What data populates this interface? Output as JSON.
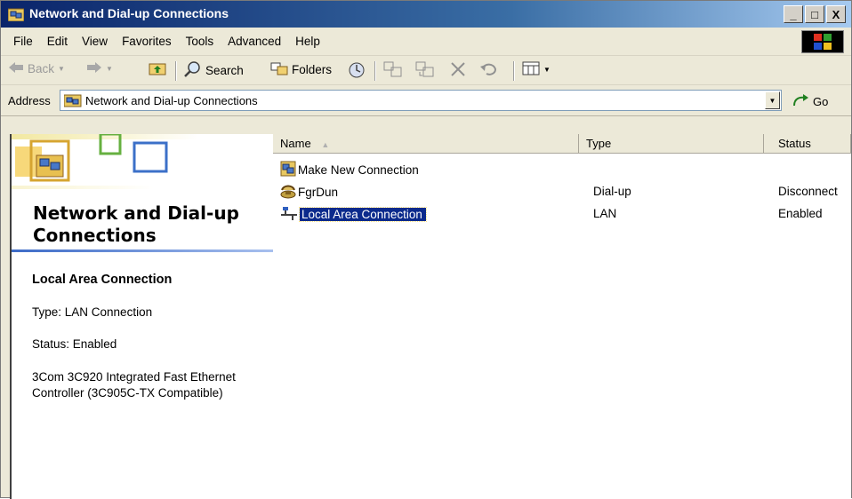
{
  "window": {
    "title": "Network and Dial-up Connections",
    "buttons": {
      "minimize": "_",
      "maximize": "□",
      "close": "X"
    }
  },
  "menu": [
    "File",
    "Edit",
    "View",
    "Favorites",
    "Tools",
    "Advanced",
    "Help"
  ],
  "toolbar": {
    "back": "Back",
    "search": "Search",
    "folders": "Folders"
  },
  "address": {
    "label": "Address",
    "value": "Network and Dial-up Connections",
    "go": "Go"
  },
  "left_pane": {
    "heading_line1": "Network and Dial-up",
    "heading_line2": "Connections",
    "selected_name": "Local Area Connection",
    "type": "Type: LAN Connection",
    "status": "Status: Enabled",
    "device_line1": "3Com 3C920 Integrated Fast Ethernet",
    "device_line2": "Controller (3C905C-TX Compatible)"
  },
  "list": {
    "columns": {
      "name": "Name",
      "type": "Type",
      "status": "Status"
    },
    "rows": [
      {
        "name": "Make New Connection",
        "type": "",
        "status": "",
        "icon": "new-connection-icon"
      },
      {
        "name": "FgrDun",
        "type": "Dial-up",
        "status": "Disconnect",
        "icon": "dialup-icon"
      },
      {
        "name": "Local Area Connection",
        "type": "LAN",
        "status": "Enabled",
        "icon": "lan-icon",
        "selected": true
      }
    ]
  },
  "colors": {
    "titlebar_start": "#0a246a",
    "titlebar_end": "#a6caf0",
    "selection": "#0b2a8c",
    "chrome": "#ece9d8"
  }
}
